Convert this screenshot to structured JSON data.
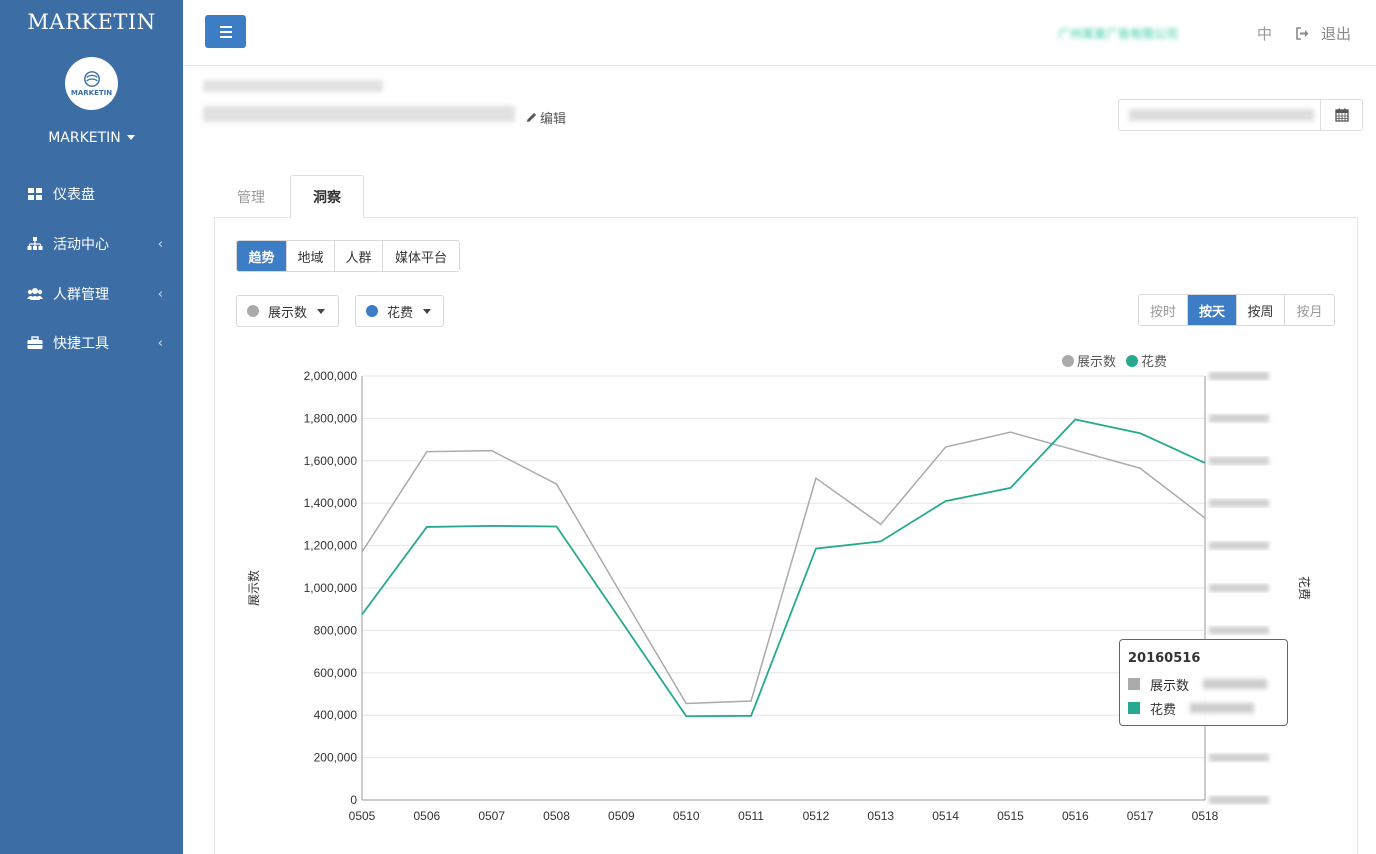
{
  "sidebar": {
    "brand": "MARKETIN",
    "logo_text": "MARKETIN",
    "user": "MARKETIN",
    "items": [
      {
        "label": "仪表盘",
        "icon": "dashboard-icon"
      },
      {
        "label": "活动中心",
        "icon": "sitemap-icon"
      },
      {
        "label": "人群管理",
        "icon": "users-icon"
      },
      {
        "label": "快捷工具",
        "icon": "briefcase-icon"
      }
    ]
  },
  "header": {
    "company": "广州某某广告有限公司",
    "lang": "中",
    "logout": "退出"
  },
  "campaign": {
    "edit_label": "编辑"
  },
  "tabs": {
    "manage": "管理",
    "insight": "洞察"
  },
  "view_tabs": [
    "趋势",
    "地域",
    "人群",
    "媒体平台"
  ],
  "metric_dropdowns": {
    "left": "展示数",
    "right": "花费"
  },
  "granularity": [
    "按时",
    "按天",
    "按周",
    "按月"
  ],
  "colors": {
    "accent": "#3c7dc6",
    "sidebar": "#3c6ea5",
    "impressions": "#aaaaaa",
    "spend": "#26a98f"
  },
  "chart_data": {
    "type": "line",
    "categories": [
      "0505",
      "0506",
      "0507",
      "0508",
      "0509",
      "0510",
      "0511",
      "0512",
      "0513",
      "0514",
      "0515",
      "0516",
      "0517",
      "0518"
    ],
    "series": [
      {
        "name": "展示数",
        "axis": "left",
        "values": [
          1170000,
          1643000,
          1648000,
          1490000,
          970000,
          455000,
          467000,
          1518000,
          1300000,
          1665000,
          1735000,
          1650000,
          1565000,
          1330000
        ]
      },
      {
        "name": "花费",
        "axis": "right",
        "values": [
          875000,
          1288000,
          1293000,
          1290000,
          843000,
          395000,
          397000,
          1186000,
          1220000,
          1410000,
          1472000,
          1795000,
          1730000,
          1590000
        ]
      }
    ],
    "ylabel": "展示数",
    "y2label": "花费",
    "ylim": [
      0,
      2000000
    ],
    "yticks": [
      "0",
      "200,000",
      "400,000",
      "600,000",
      "800,000",
      "1,000,000",
      "1,200,000",
      "1,400,000",
      "1,600,000",
      "1,800,000",
      "2,000,000"
    ],
    "legend": [
      "展示数",
      "花费"
    ],
    "tooltip": {
      "title": "20160516",
      "rows": [
        "展示数",
        "花费"
      ]
    }
  }
}
